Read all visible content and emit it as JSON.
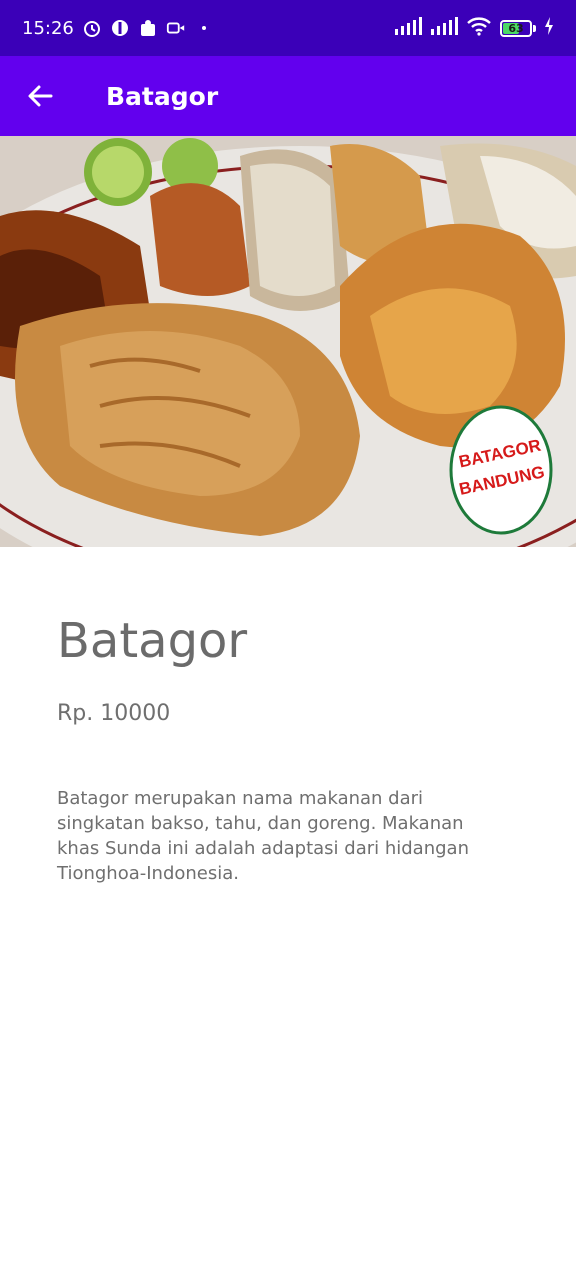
{
  "status_bar": {
    "time": "15:26",
    "battery_level": "63",
    "battery_fraction": 0.63,
    "icons": [
      "alarm-icon",
      "shield-icon",
      "puzzle-icon",
      "video-icon",
      "dot-icon",
      "signal-icon",
      "signal-icon",
      "wifi-icon",
      "battery-icon",
      "charging-icon"
    ]
  },
  "app_bar": {
    "back_icon": "arrow-left-icon",
    "title": "Batagor"
  },
  "hero": {
    "stamp_line1": "BATAGOR",
    "stamp_line2": "BANDUNG"
  },
  "detail": {
    "name": "Batagor",
    "price": "Rp. 10000",
    "description": "Batagor merupakan nama makanan dari singkatan bakso, tahu, dan goreng. Makanan khas Sunda ini adalah adaptasi dari hidangan Tionghoa-Indonesia."
  },
  "colors": {
    "status_bar": "#3b00b8",
    "app_bar": "#6200ee",
    "text": "#6f6f6f"
  }
}
